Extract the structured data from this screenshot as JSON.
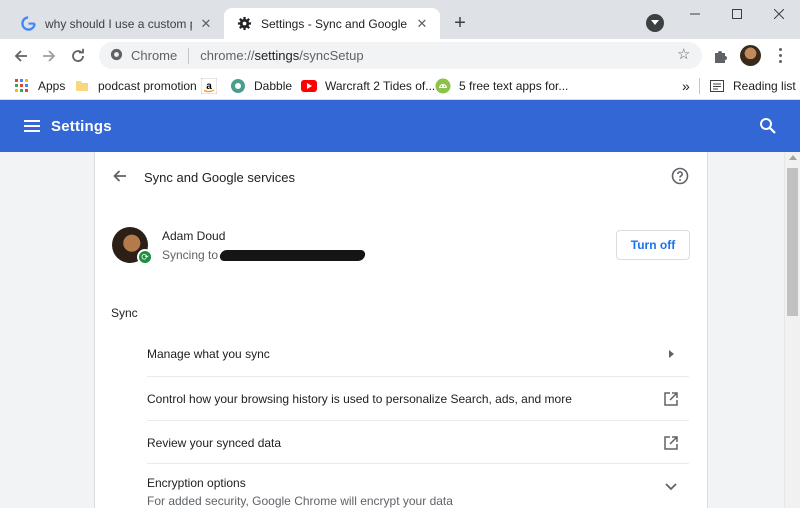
{
  "tabs": [
    {
      "title": "why should I use a custom passp",
      "favicon": "google-g-icon"
    },
    {
      "title": "Settings - Sync and Google servic",
      "favicon": "settings-gear-icon"
    }
  ],
  "toolbar": {
    "omnibox_chip": "Chrome",
    "url_scheme": "chrome://",
    "url_host": "settings",
    "url_path": "/syncSetup"
  },
  "bookmarks": {
    "items": [
      {
        "label": "Apps",
        "icon": "apps-grid-icon"
      },
      {
        "label": "podcast promotion",
        "icon": "folder-icon"
      },
      {
        "label": "",
        "icon": "amazon-icon"
      },
      {
        "label": "Dabble",
        "icon": "dabble-icon"
      },
      {
        "label": "Warcraft 2 Tides of...",
        "icon": "youtube-icon"
      },
      {
        "label": "5 free text apps for...",
        "icon": "android-icon"
      }
    ],
    "overflow": "»",
    "reading_list": "Reading list"
  },
  "header": {
    "title": "Settings"
  },
  "page": {
    "heading": "Sync and Google services",
    "account": {
      "name": "Adam Doud",
      "status_prefix": "Syncing to"
    },
    "turn_off_label": "Turn off",
    "section_label": "Sync",
    "rows": [
      {
        "label": "Manage what you sync",
        "trail_icon": "arrow-right-icon"
      },
      {
        "label": "Control how your browsing history is used to personalize Search, ads, and more",
        "trail_icon": "external-link-icon"
      },
      {
        "label": "Review your synced data",
        "trail_icon": "external-link-icon"
      },
      {
        "label": "Encryption options",
        "sublabel": "For added security, Google Chrome will encrypt your data",
        "trail_icon": "chevron-down-icon"
      }
    ]
  },
  "colors": {
    "header_blue": "#3367d6",
    "link_blue": "#1a73e8",
    "sync_green": "#1e8e3e"
  }
}
